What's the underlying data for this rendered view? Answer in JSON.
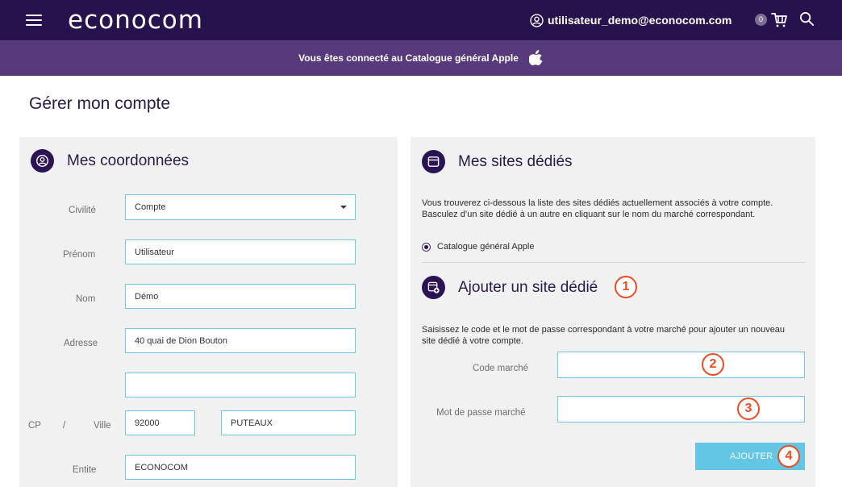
{
  "header": {
    "logo": "econocom",
    "user_email": "utilisateur_demo@econocom.com",
    "cart_count": "0",
    "menu_icon": "hamburger-menu-icon",
    "user_icon": "user-icon",
    "cart_icon": "cart-icon",
    "search_icon": "search-icon",
    "background": "#28124d"
  },
  "banner": {
    "text": "Vous êtes connecté au Catalogue général Apple",
    "icon": "apple-icon",
    "background": "#573a7c"
  },
  "page": {
    "title": "Gérer mon compte"
  },
  "coordonnees": {
    "title": "Mes coordonnées",
    "icon": "user-circle-icon",
    "fields": {
      "civilite_label": "Civilité",
      "civilite_value": "Compte",
      "prenom_label": "Prénom",
      "prenom_value": "Utilisateur",
      "nom_label": "Nom",
      "nom_value": "Démo",
      "adresse_label": "Adresse",
      "adresse_value": "40 quai de Dion Bouton",
      "adresse2_value": "",
      "cp_label": "CP",
      "slash": "/",
      "ville_label": "Ville",
      "cp_value": "92000",
      "ville_value": "PUTEAUX",
      "entite_label": "Entite",
      "entite_value": "ECONOCOM"
    }
  },
  "sites": {
    "title": "Mes sites dédiés",
    "icon": "browser-window-icon",
    "description": "Vous trouverez ci-dessous la liste des sites dédiés actuellement associés à votre compte. Basculez d’un site dédié à un autre en cliquant sur le nom du marché correspondant.",
    "selected_site": "Catalogue général Apple",
    "add": {
      "title": "Ajouter un site dédié",
      "icon": "browser-add-icon",
      "description": "Saisissez le code et le mot de passe correspondant à votre marché pour ajouter un nouveau site dédié à votre compte.",
      "code_label": "Code marché",
      "code_value": "",
      "password_label": "Mot de passe marché",
      "password_value": "",
      "button_label": "AJOUTER"
    }
  },
  "annotations": {
    "badge_1": "1",
    "badge_2": "2",
    "badge_3": "3",
    "badge_4": "4",
    "color": "#ee4a22"
  },
  "colors": {
    "panel_bg": "#f1f1f1",
    "input_border": "#6dc9dd",
    "button_bg": "#62c6e4",
    "icon_circle": "#2a1454"
  }
}
